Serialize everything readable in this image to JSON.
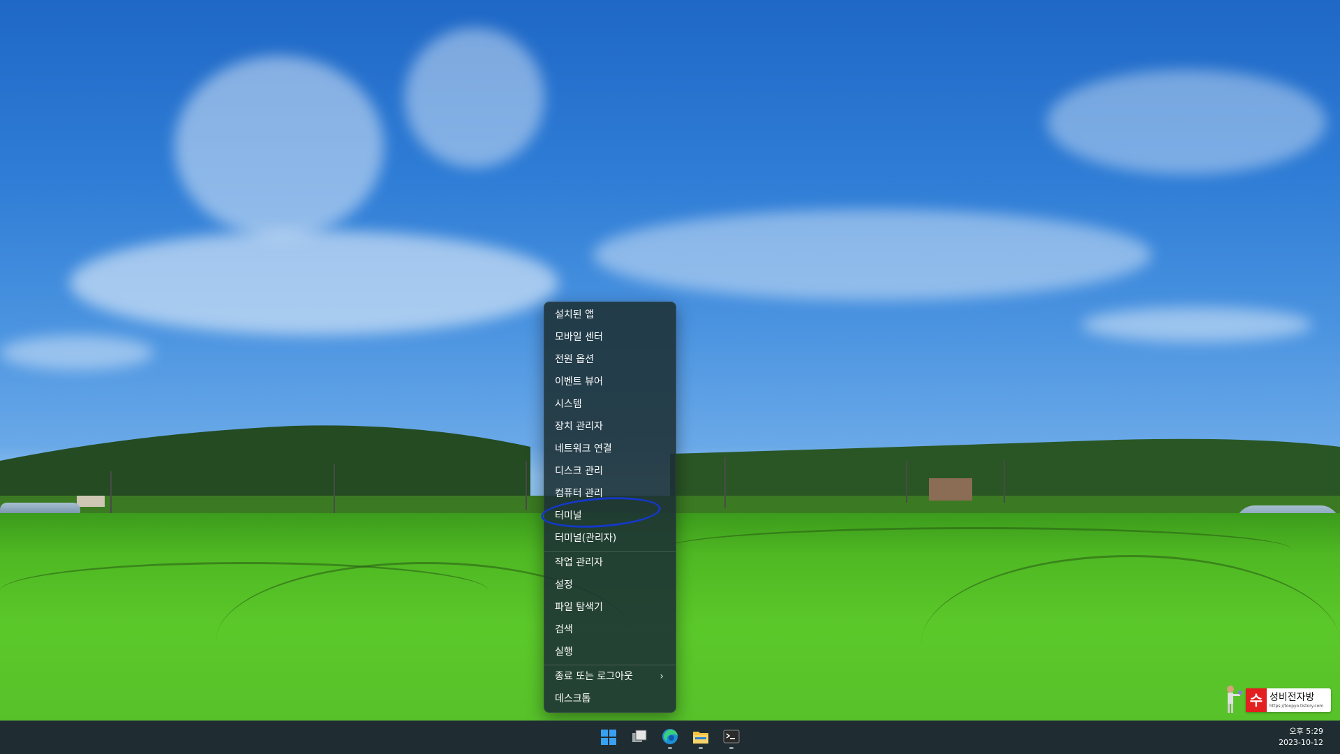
{
  "context_menu": {
    "items": [
      {
        "label": "설치된 앱"
      },
      {
        "label": "모바일 센터"
      },
      {
        "label": "전원 옵션"
      },
      {
        "label": "이벤트 뷰어"
      },
      {
        "label": "시스템"
      },
      {
        "label": "장치 관리자"
      },
      {
        "label": "네트워크 연결"
      },
      {
        "label": "디스크 관리"
      },
      {
        "label": "컴퓨터 관리"
      },
      {
        "label": "터미널"
      },
      {
        "label": "터미널(관리자)"
      },
      {
        "label": "작업 관리자"
      },
      {
        "label": "설정"
      },
      {
        "label": "파일 탐색기"
      },
      {
        "label": "검색"
      },
      {
        "label": "실행"
      },
      {
        "label": "종료 또는 로그아웃"
      },
      {
        "label": "데스크톱"
      }
    ],
    "submenu_arrow": "›",
    "highlighted_item": "터미널"
  },
  "taskbar": {
    "icons": [
      "windows-start-icon",
      "task-view-icon",
      "edge-browser-icon",
      "file-explorer-icon",
      "terminal-icon"
    ],
    "clock": {
      "time": "오후 5:29",
      "date": "2023-10-12"
    }
  },
  "watermark": {
    "badge": "수",
    "name": "성비전자방",
    "url": "https://toopyo.tistory.com"
  },
  "colors": {
    "menu_bg": "#1c3034",
    "taskbar_bg": "#1f2d32",
    "highlight_ring": "#1438c8",
    "watermark_red": "#e32020"
  }
}
